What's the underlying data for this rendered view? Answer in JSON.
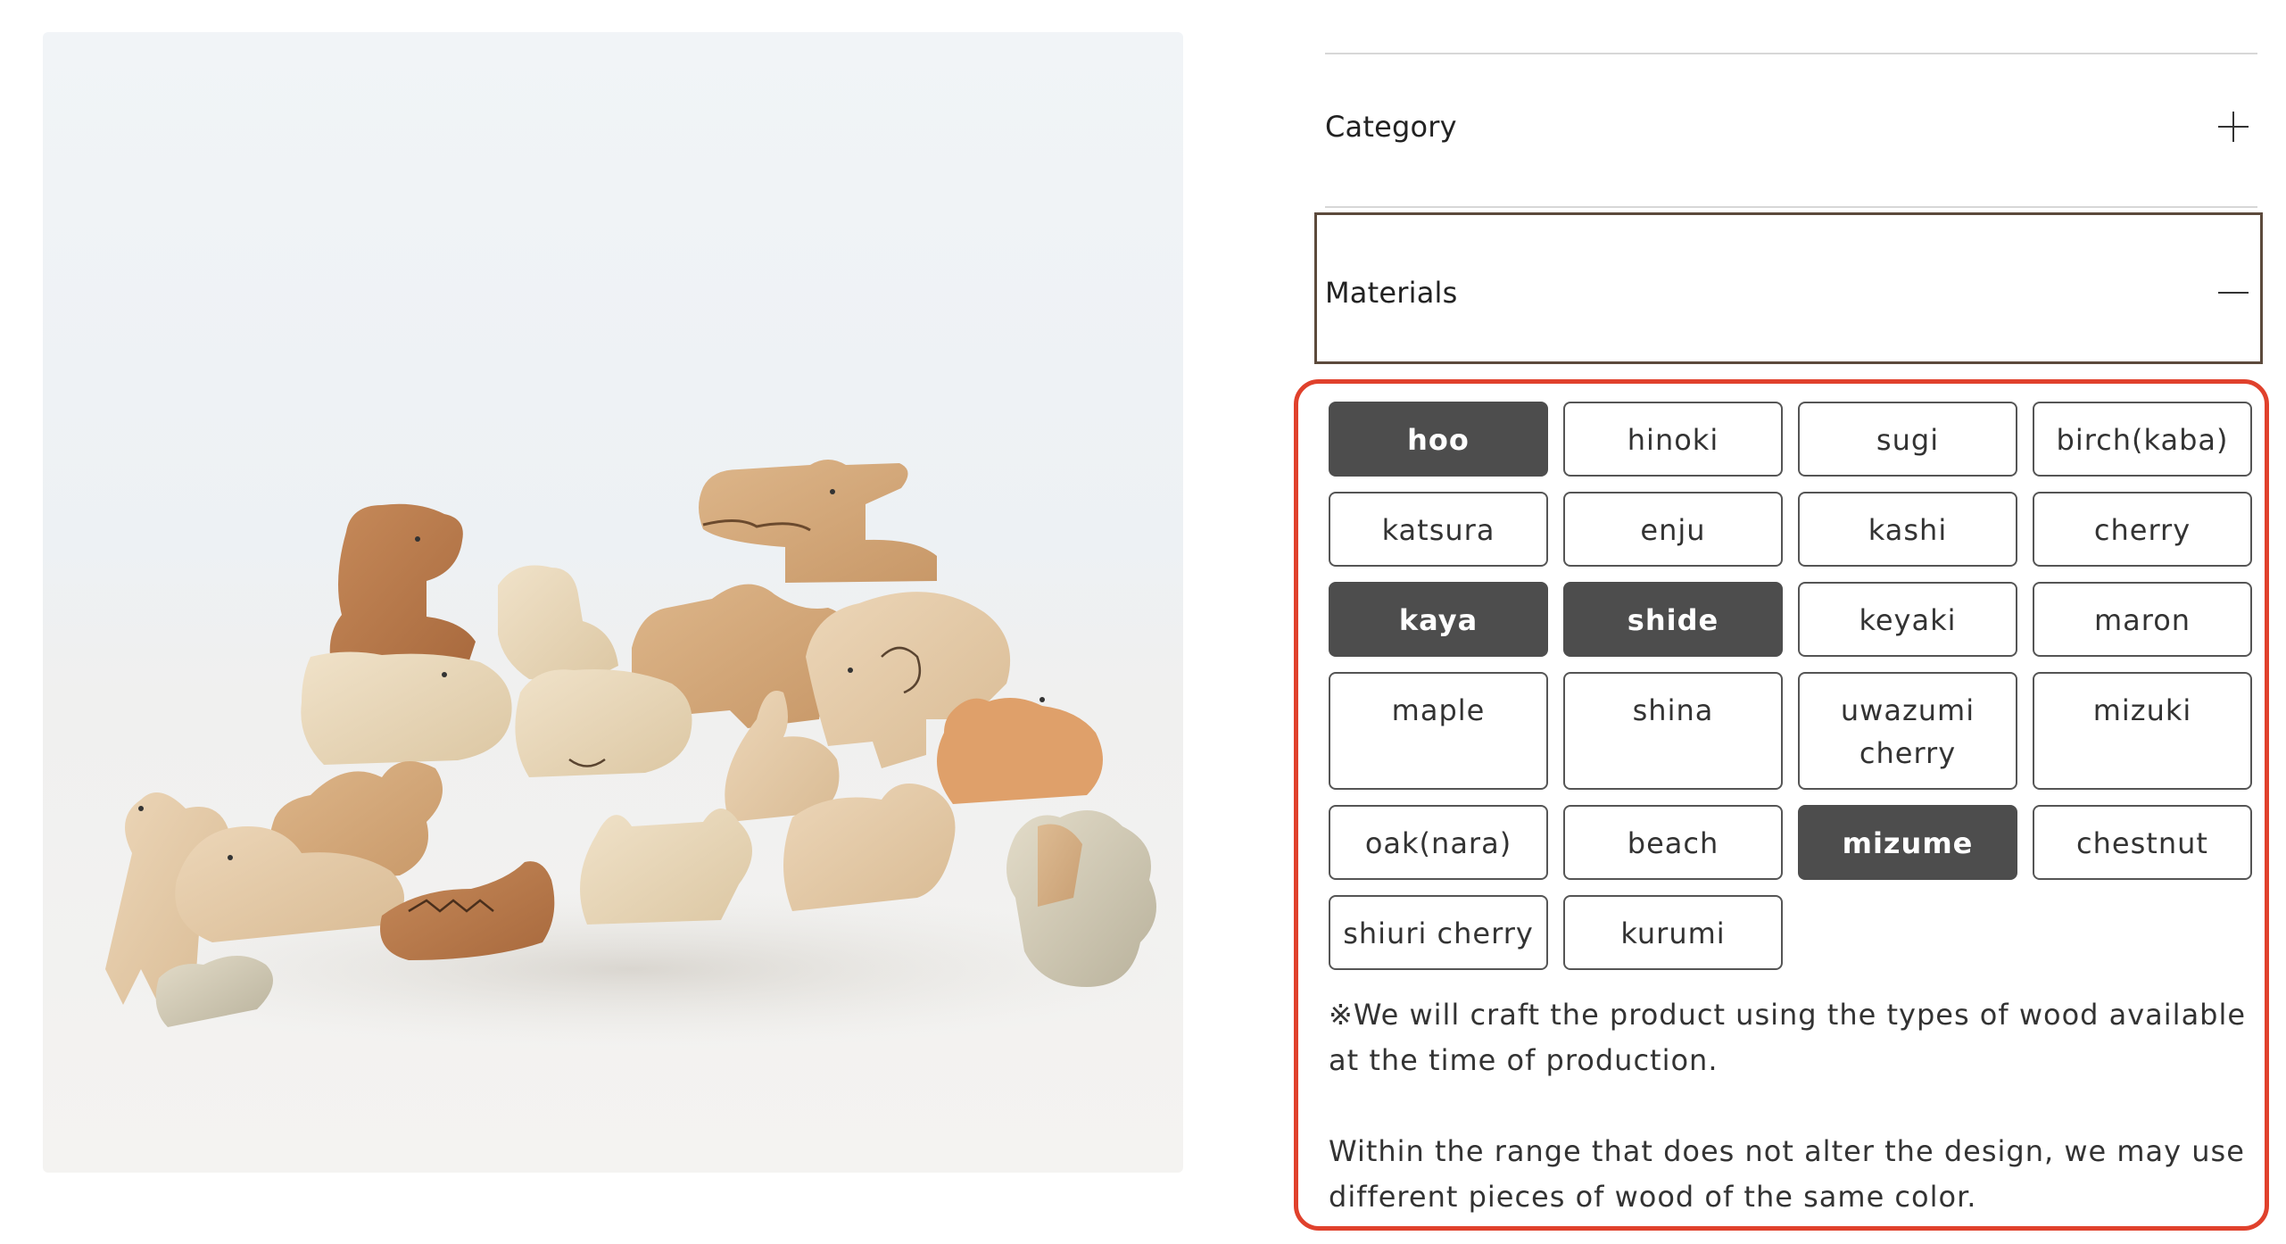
{
  "product_photo": {
    "alt": "Stacked wooden animal toy figures",
    "icon": "product-photo"
  },
  "accordion": {
    "category": {
      "label": "Category",
      "icon": "plus-icon",
      "expanded": false
    },
    "materials": {
      "label": "Materials",
      "icon": "minus-icon",
      "expanded": true
    }
  },
  "materials": {
    "options": [
      {
        "label": "hoo",
        "selected": true
      },
      {
        "label": "hinoki",
        "selected": false
      },
      {
        "label": "sugi",
        "selected": false
      },
      {
        "label": "birch(kaba)",
        "selected": false
      },
      {
        "label": "katsura",
        "selected": false
      },
      {
        "label": "enju",
        "selected": false
      },
      {
        "label": "kashi",
        "selected": false
      },
      {
        "label": "cherry",
        "selected": false
      },
      {
        "label": "kaya",
        "selected": true
      },
      {
        "label": "shide",
        "selected": true
      },
      {
        "label": "keyaki",
        "selected": false
      },
      {
        "label": "maron",
        "selected": false
      },
      {
        "label": "maple",
        "selected": false
      },
      {
        "label": "shina",
        "selected": false
      },
      {
        "label": "uwazumi cherry",
        "selected": false
      },
      {
        "label": "mizuki",
        "selected": false
      },
      {
        "label": "oak(nara)",
        "selected": false
      },
      {
        "label": "beach",
        "selected": false
      },
      {
        "label": "mizume",
        "selected": true
      },
      {
        "label": "chestnut",
        "selected": false
      },
      {
        "label": "shiuri cherry",
        "selected": false
      },
      {
        "label": "kurumi",
        "selected": false
      }
    ],
    "note_1": "※We will craft the product using the types of wood available at the time of production.",
    "note_2": "Within the range that does not alter the design, we may use different pieces of wood of the same color."
  },
  "colors": {
    "selected_chip": "#4d4d4d",
    "highlight_border": "#e0412c",
    "focus_border": "#5c4a3c"
  }
}
